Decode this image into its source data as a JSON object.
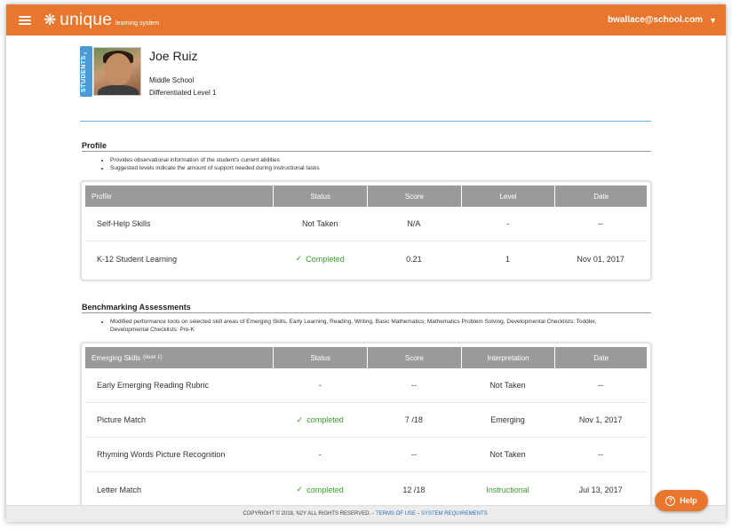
{
  "header": {
    "logo_word": "unique",
    "logo_sub": "learning system",
    "user_email": "bwallace@school.com"
  },
  "student": {
    "tab_label": "STUDENTS",
    "name": "Joe Ruiz",
    "school": "Middle School",
    "level": "Differentiated Level 1"
  },
  "profile_section": {
    "title": "Profile",
    "bullets": [
      "Provides observational information of the student's current abilities",
      "Suggested levels indicate the amount of support needed during instructional tasks"
    ],
    "columns": [
      "Profile",
      "Status",
      "Score",
      "Level",
      "Date"
    ],
    "rows": [
      {
        "name": "Self-Help Skills",
        "status": "Not Taken",
        "score": "N/A",
        "level": "-",
        "date": "--"
      },
      {
        "name": "K-12 Student Learning",
        "status": "Completed",
        "score": "0.21",
        "level": "1",
        "date": "Nov 01, 2017"
      }
    ]
  },
  "benchmark_section": {
    "title": "Benchmarking Assessments",
    "bullets": [
      "Modified performance tools on selected skill areas of Emerging Skills, Early Learning, Reading, Writing, Basic Mathematics, Mathematics Problem Solving, Developmental Checklists: Toddler, Developmental Checklists: Pre-K"
    ],
    "columns": [
      "Emerging Skills",
      "Status",
      "Score",
      "Interpretation",
      "Date"
    ],
    "columns_sub": "(level 1)",
    "rows": [
      {
        "name": "Early Emerging Reading Rubric",
        "status": "-",
        "score": "--",
        "interpretation": "Not Taken",
        "date": "--"
      },
      {
        "name": "Picture Match",
        "status": "completed",
        "score": "7 /18",
        "interpretation": "Emerging",
        "date": "Nov 1, 2017"
      },
      {
        "name": "Rhyming Words Picture Recognition",
        "status": "-",
        "score": "--",
        "interpretation": "Not Taken",
        "date": "--"
      },
      {
        "name": "Letter Match",
        "status": "completed",
        "score": "12 /18",
        "interpretation": "Instructional",
        "date": "Jul 13, 2017"
      }
    ]
  },
  "footer": {
    "copyright": "COPYRIGHT © 2018, N2Y ALL RIGHTS RESERVED. -",
    "terms": "TERMS OF USE",
    "sep": "-",
    "sysreq": "SYSTEM REQUIREMENTS"
  },
  "help": {
    "label": "Help"
  },
  "colors": {
    "brand": "#e8762c",
    "accent": "#4a9ad6",
    "success": "#3a9a2a",
    "table_header": "#9a9a9a"
  },
  "icons": [
    "hamburger-icon",
    "snowflake-logo-icon",
    "chevron-down-icon",
    "checkmark-icon",
    "question-icon"
  ]
}
